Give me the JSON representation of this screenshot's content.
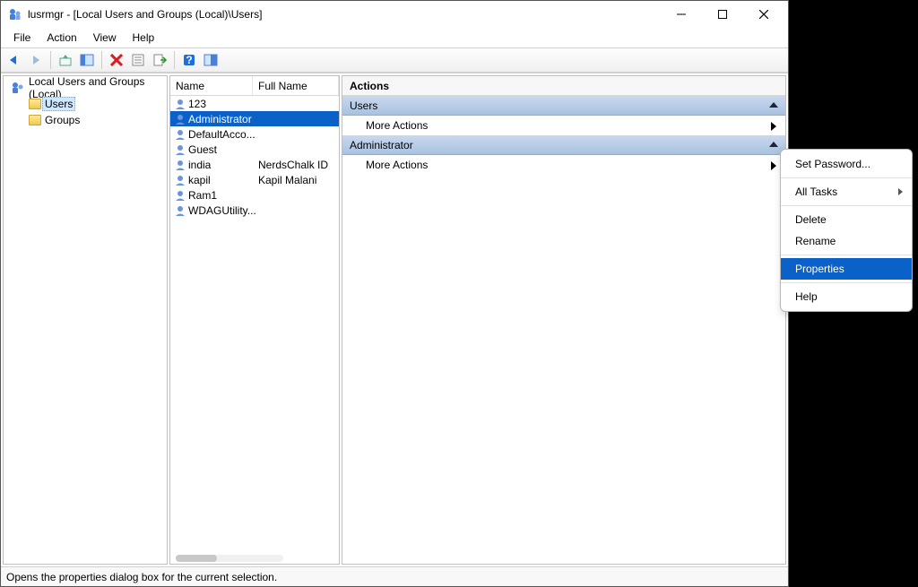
{
  "window": {
    "title": "lusrmgr - [Local Users and Groups (Local)\\Users]"
  },
  "menu": {
    "file": "File",
    "action": "Action",
    "view": "View",
    "help": "Help"
  },
  "tree": {
    "root": "Local Users and Groups (Local)",
    "users": "Users",
    "groups": "Groups"
  },
  "list": {
    "col_name": "Name",
    "col_full": "Full Name",
    "rows": [
      {
        "name": "123",
        "full": ""
      },
      {
        "name": "Administrator",
        "full": "",
        "selected": true
      },
      {
        "name": "DefaultAcco...",
        "full": ""
      },
      {
        "name": "Guest",
        "full": ""
      },
      {
        "name": "india",
        "full": "NerdsChalk ID"
      },
      {
        "name": "kapil",
        "full": "Kapil Malani"
      },
      {
        "name": "Ram1",
        "full": ""
      },
      {
        "name": "WDAGUtility...",
        "full": ""
      }
    ]
  },
  "actions": {
    "title": "Actions",
    "group1": "Users",
    "more1": "More Actions",
    "group2": "Administrator",
    "more2": "More Actions"
  },
  "context": {
    "set_password": "Set Password...",
    "all_tasks": "All Tasks",
    "delete": "Delete",
    "rename": "Rename",
    "properties": "Properties",
    "help": "Help"
  },
  "status": "Opens the properties dialog box for the current selection."
}
